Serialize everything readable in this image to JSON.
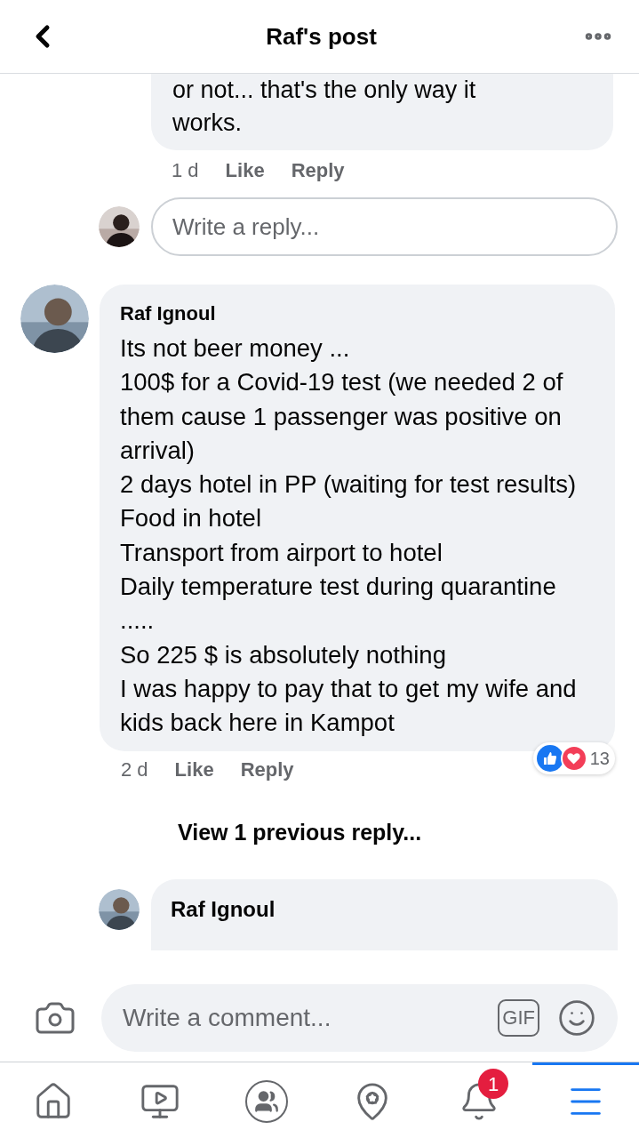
{
  "header": {
    "title": "Raf's post"
  },
  "top_reply": {
    "text": "or not... that's the only way it works.",
    "time": "1 d",
    "actions": [
      "Like",
      "Reply"
    ]
  },
  "reply_field": {
    "placeholder": "Write a reply..."
  },
  "comment": {
    "author": "Raf Ignoul",
    "lines": [
      "Its not beer money ...",
      "100$ for a Covid-19 test (we needed 2 of them cause 1 passenger was positive on arrival)",
      "2 days hotel in PP (waiting for test results)",
      "Food in hotel",
      "Transport from airport to hotel",
      "Daily temperature test during quarantine",
      ".....",
      "So 225 $ is absolutely nothing",
      "I was happy to pay that to get my wife and kids back here in Kampot"
    ],
    "time": "2 d",
    "actions": [
      "Like",
      "Reply"
    ],
    "reaction_count": "13"
  },
  "view_previous": "View 1 previous reply...",
  "reply_preview": {
    "author": "Raf Ignoul"
  },
  "composer": {
    "placeholder": "Write a comment...",
    "gif": "GIF"
  },
  "tabs": [
    {
      "kind": "home",
      "selected": false
    },
    {
      "kind": "video",
      "selected": false
    },
    {
      "kind": "groups",
      "selected": false
    },
    {
      "kind": "places",
      "selected": false
    },
    {
      "kind": "notifications",
      "selected": false,
      "badge": "1"
    },
    {
      "kind": "menu",
      "selected": true
    }
  ]
}
